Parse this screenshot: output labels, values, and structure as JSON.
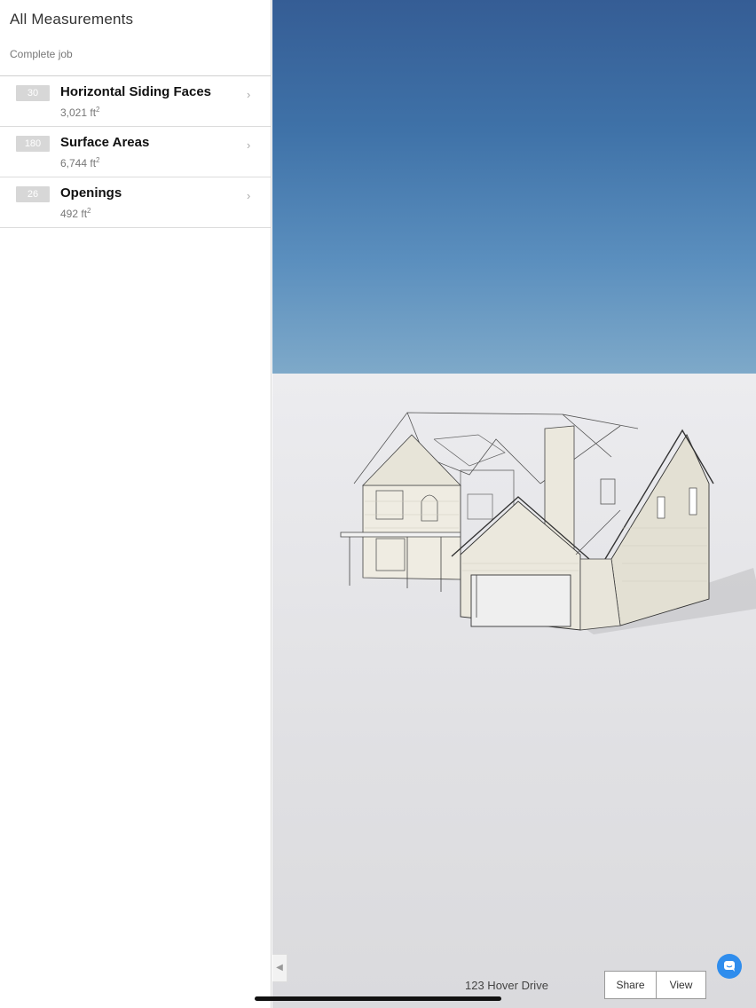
{
  "sidebar": {
    "title": "All Measurements",
    "subtitle": "Complete job",
    "items": [
      {
        "count": "30",
        "name": "Horizontal Siding Faces",
        "area": "3,021 ft",
        "unit_exp": "2"
      },
      {
        "count": "180",
        "name": "Surface Areas",
        "area": "6,744 ft",
        "unit_exp": "2"
      },
      {
        "count": "26",
        "name": "Openings",
        "area": "492 ft",
        "unit_exp": "2"
      }
    ]
  },
  "viewer": {
    "address": "123 Hover Drive",
    "share_label": "Share",
    "view_label": "View",
    "icons": {
      "collapse": "chevron-left-icon",
      "chat": "chat-icon",
      "chevron": "chevron-right-icon"
    },
    "colors": {
      "sky_top": "#355d95",
      "ground": "#e0e0e3",
      "chat_accent": "#2f8ded"
    }
  }
}
